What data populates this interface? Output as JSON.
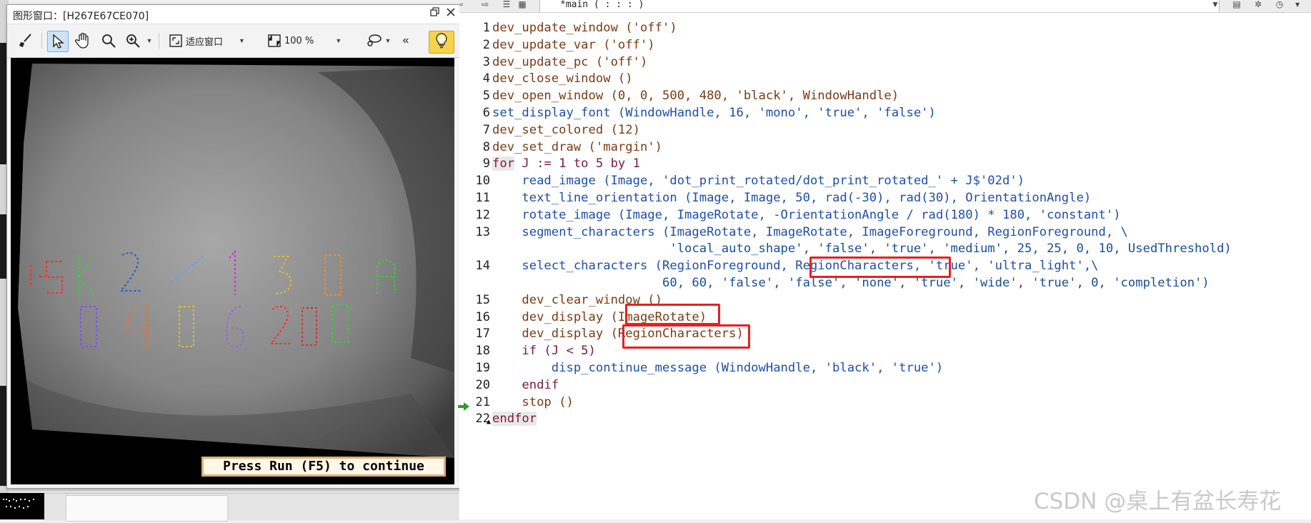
{
  "graphics_window": {
    "title": "图形窗口：[H267E67CE070]",
    "toolbar": {
      "fit_label": "适应窗口",
      "zoom_label": "100 %"
    },
    "message": "Press Run (F5) to continue",
    "colors": {
      "accent_bulb": "#f5d34a",
      "message_border": "#d9b27a"
    }
  },
  "editor": {
    "procedure_selector": "*main ( : : : )",
    "code_lines": [
      {
        "num": "1",
        "text": "dev_update_window ('off')"
      },
      {
        "num": "2",
        "text": "dev_update_var ('off')"
      },
      {
        "num": "3",
        "text": "dev_update_pc ('off')"
      },
      {
        "num": "4",
        "text": "dev_close_window ()"
      },
      {
        "num": "5",
        "text": "dev_open_window (0, 0, 500, 480, 'black', WindowHandle)"
      },
      {
        "num": "6",
        "text": "set_display_font (WindowHandle, 16, 'mono', 'true', 'false')"
      },
      {
        "num": "7",
        "text": "dev_set_colored (12)"
      },
      {
        "num": "8",
        "text": "dev_set_draw ('margin')"
      },
      {
        "num": "9",
        "text": "for J := 1 to 5 by 1"
      },
      {
        "num": "10",
        "text": "    read_image (Image, 'dot_print_rotated/dot_print_rotated_' + J$'02d')"
      },
      {
        "num": "11",
        "text": "    text_line_orientation (Image, Image, 50, rad(-30), rad(30), OrientationAngle)"
      },
      {
        "num": "12",
        "text": "    rotate_image (Image, ImageRotate, -OrientationAngle / rad(180) * 180, 'constant')"
      },
      {
        "num": "13",
        "text": "    segment_characters (ImageRotate, ImageRotate, ImageForeground, RegionForeground, \\"
      },
      {
        "num": "",
        "text": "                        'local_auto_shape', 'false', 'true', 'medium', 25, 25, 0, 10, UsedThreshold)"
      },
      {
        "num": "14",
        "text": "    select_characters (RegionForeground, RegionCharacters, 'true', 'ultra_light',\\"
      },
      {
        "num": "",
        "text": "                       60, 60, 'false', 'false', 'none', 'true', 'wide', 'true', 0, 'completion')"
      },
      {
        "num": "15",
        "text": "    dev_clear_window ()"
      },
      {
        "num": "16",
        "text": "    dev_display (ImageRotate)"
      },
      {
        "num": "17",
        "text": "    dev_display (RegionCharacters)"
      },
      {
        "num": "18",
        "text": "    if (J < 5)"
      },
      {
        "num": "19",
        "text": "        disp_continue_message (WindowHandle, 'black', 'true')"
      },
      {
        "num": "20",
        "text": "    endif"
      },
      {
        "num": "21",
        "text": "    stop ()"
      },
      {
        "num": "22",
        "text": "endfor"
      }
    ],
    "highlight_color": "#e62020"
  },
  "watermark": "CSDN @桌上有盆长寿花"
}
